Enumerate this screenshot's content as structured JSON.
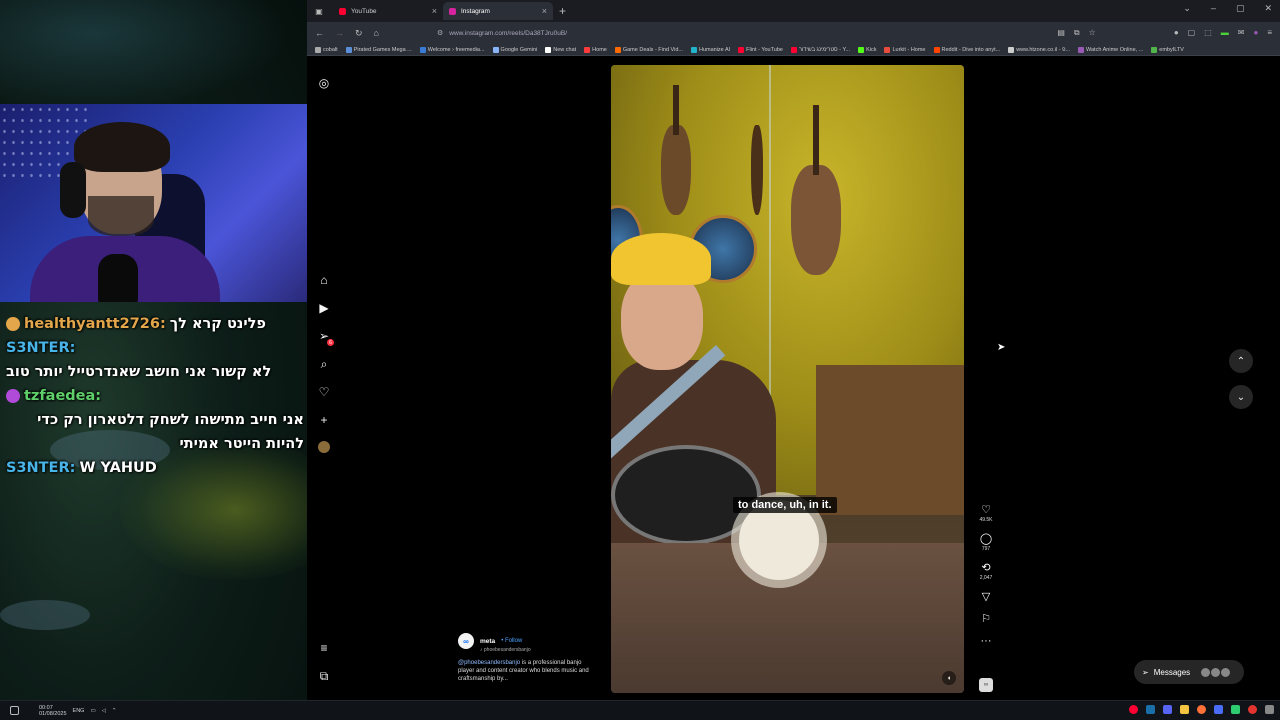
{
  "chat": [
    {
      "user": "healthyantt2726:",
      "user_color": "#e3a64b",
      "message": "פלינט קרא לך",
      "badge_color": "#e3a64b"
    },
    {
      "user": "S3NTER:",
      "user_color": "#48b4e8",
      "message": "לא קשור אני חושב שאנדרטייל יותר טוב",
      "badge_color": ""
    },
    {
      "user": "tzfaedea:",
      "user_color": "#5fcf6a",
      "message": "אני חייב מתישהו לשחק דלטארון רק כדי להיות הייטר אמיתי",
      "badge_color": "#b04ad8"
    },
    {
      "user": "S3NTER:",
      "user_color": "#48b4e8",
      "message": "W YAHUD",
      "badge_color": ""
    }
  ],
  "taskbar": {
    "time": "00:07",
    "date": "01/08/2025",
    "lang": "ENG"
  },
  "browser": {
    "tabs": [
      {
        "label": "YouTube",
        "icon": "youtube-icon",
        "color": "#ff0033",
        "active": false
      },
      {
        "label": "Instagram",
        "icon": "instagram-icon",
        "color": "#d6249f",
        "active": true
      }
    ],
    "url": "www.instagram.com/reels/Da38TJru0uB/",
    "bookmarks": [
      {
        "label": "cobalt",
        "color": "#aaaaaa"
      },
      {
        "label": "Pirated Games Mega ...",
        "color": "#5a8fd8"
      },
      {
        "label": "Welcome › freemedia...",
        "color": "#3a7bd5"
      },
      {
        "label": "Google Gemini",
        "color": "#8ab4f8"
      },
      {
        "label": "New chat",
        "color": "#ffffff"
      },
      {
        "label": "Home",
        "color": "#ff3b3b"
      },
      {
        "label": "Game Deals - Find Vid...",
        "color": "#ff6a00"
      },
      {
        "label": "Humanize AI",
        "color": "#21b3c9"
      },
      {
        "label": "Flint - YouTube",
        "color": "#ff0033"
      },
      {
        "label": "סטרימינג בשידור - Y...",
        "color": "#ff0033"
      },
      {
        "label": "Kick",
        "color": "#53fc18"
      },
      {
        "label": "Lurkit - Home",
        "color": "#e84c3d"
      },
      {
        "label": "Reddit - Dive into anyt...",
        "color": "#ff4500"
      },
      {
        "label": "www.htzone.co.il - פ...",
        "color": "#cccccc"
      },
      {
        "label": "Watch Anime Online, ...",
        "color": "#9b59b6"
      },
      {
        "label": "embyILTV",
        "color": "#52b54b"
      }
    ]
  },
  "instagram": {
    "nav_icons": [
      "instagram-logo-icon",
      "home-icon",
      "reels-icon",
      "messages-icon",
      "search-icon",
      "heart-icon",
      "create-icon",
      "profile-avatar-icon",
      "menu-icon",
      "also-from-meta-icon"
    ],
    "notification_count": "6",
    "reel": {
      "caption": "to dance, uh, in it.",
      "author": "meta",
      "follow_label": "Follow",
      "collab": "phoebesandersbanjo",
      "description_mention": "@phoebesandersbanjo",
      "description": " is a professional banjo player and content creator who blends music and craftsmanship by...",
      "likes": "49.5K",
      "comments": "797",
      "reposts": "2,047"
    },
    "messages_label": "Messages"
  }
}
